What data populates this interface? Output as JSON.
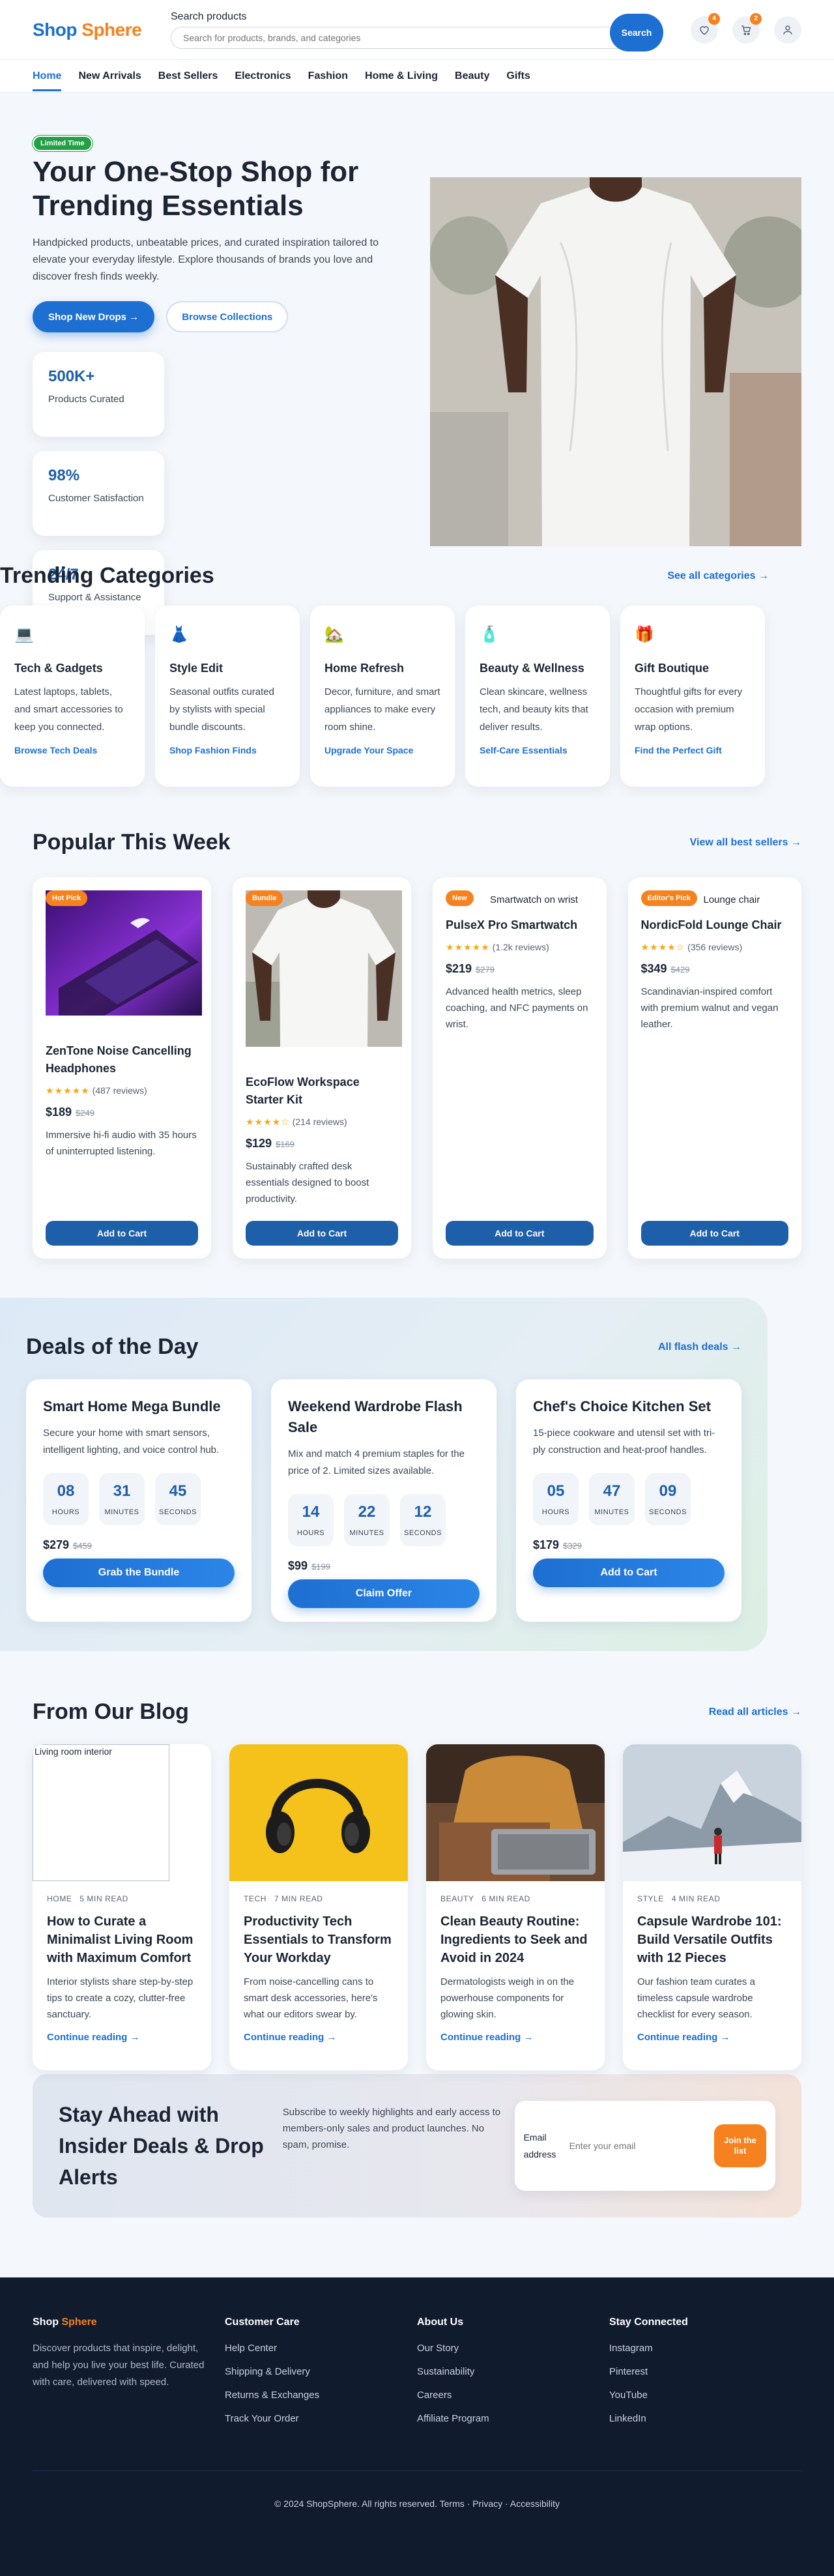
{
  "header": {
    "logo_part1": "Shop",
    "logo_part2": "Sphere",
    "search_label": "Search products",
    "search_placeholder": "Search for products, brands, and categories",
    "search_button": "Search",
    "wishlist_count": "4",
    "cart_count": "2"
  },
  "nav": {
    "items": [
      "Home",
      "New Arrivals",
      "Best Sellers",
      "Electronics",
      "Fashion",
      "Home & Living",
      "Beauty",
      "Gifts"
    ]
  },
  "hero": {
    "tag": "Limited Time",
    "title": "Your One-Stop Shop for Trending Essentials",
    "lead": "Handpicked products, unbeatable prices, and curated inspiration tailored to elevate your everyday lifestyle. Explore thousands of brands you love and discover fresh finds weekly.",
    "primary_cta": "Shop New Drops →",
    "secondary_cta": "Browse Collections",
    "stats": [
      {
        "value": "500K+",
        "label": "Products Curated"
      },
      {
        "value": "98%",
        "label": "Customer Satisfaction"
      },
      {
        "value": "24/7",
        "label": "Support & Assistance"
      }
    ]
  },
  "categories": {
    "title": "Trending Categories",
    "see_all": "See all categories →",
    "items": [
      {
        "icon": "laptop-icon",
        "glyph": "💻",
        "title": "Tech & Gadgets",
        "desc": "Latest laptops, tablets, and smart accessories to keep you connected.",
        "link": "Browse Tech Deals"
      },
      {
        "icon": "dress-icon",
        "glyph": "👗",
        "title": "Style Edit",
        "desc": "Seasonal outfits curated by stylists with special bundle discounts.",
        "link": "Shop Fashion Finds"
      },
      {
        "icon": "house-icon",
        "glyph": "🏡",
        "title": "Home Refresh",
        "desc": "Decor, furniture, and smart appliances to make every room shine.",
        "link": "Upgrade Your Space"
      },
      {
        "icon": "lotion-icon",
        "glyph": "🧴",
        "title": "Beauty & Wellness",
        "desc": "Clean skincare, wellness tech, and beauty kits that deliver results.",
        "link": "Self-Care Essentials"
      },
      {
        "icon": "gift-icon",
        "glyph": "🎁",
        "title": "Gift Boutique",
        "desc": "Thoughtful gifts for every occasion with premium wrap options.",
        "link": "Find the Perfect Gift"
      }
    ]
  },
  "popular": {
    "title": "Popular This Week",
    "view_all": "View all best sellers →",
    "add_label": "Add to Cart",
    "products": [
      {
        "tag": "Hot Pick",
        "name": "ZenTone Noise Cancelling Headphones",
        "stars": "★★★★★",
        "reviews": "(487 reviews)",
        "price": "$189",
        "old": "$249",
        "desc": "Immersive hi-fi audio with 35 hours of uninterrupted listening."
      },
      {
        "tag": "Bundle",
        "name": "EcoFlow Workspace Starter Kit",
        "stars": "★★★★☆",
        "reviews": "(214 reviews)",
        "price": "$129",
        "old": "$169",
        "desc": "Sustainably crafted desk essentials designed to boost productivity."
      },
      {
        "tag": "New",
        "alt": "Smartwatch on wrist",
        "name": "PulseX Pro Smartwatch",
        "stars": "★★★★★",
        "reviews": "(1.2k reviews)",
        "price": "$219",
        "old": "$279",
        "desc": "Advanced health metrics, sleep coaching, and NFC payments on wrist."
      },
      {
        "tag": "Editor's Pick",
        "alt": "Lounge chair",
        "name": "NordicFold Lounge Chair",
        "stars": "★★★★☆",
        "reviews": "(356 reviews)",
        "price": "$349",
        "old": "$429",
        "desc": "Scandinavian-inspired comfort with premium walnut and vegan leather."
      }
    ]
  },
  "deals": {
    "title": "Deals of the Day",
    "all_link": "All flash deals →",
    "units": [
      "HOURS",
      "MINUTES",
      "SECONDS"
    ],
    "items": [
      {
        "title": "Smart Home Mega Bundle",
        "desc": "Secure your home with smart sensors, intelligent lighting, and voice control hub.",
        "h": "08",
        "m": "31",
        "s": "45",
        "price": "$279",
        "old": "$459",
        "cta": "Grab the Bundle"
      },
      {
        "title": "Weekend Wardrobe Flash Sale",
        "desc": "Mix and match 4 premium staples for the price of 2. Limited sizes available.",
        "h": "14",
        "m": "22",
        "s": "12",
        "price": "$99",
        "old": "$199",
        "cta": "Claim Offer"
      },
      {
        "title": "Chef's Choice Kitchen Set",
        "desc": "15-piece cookware and utensil set with tri-ply construction and heat-proof handles.",
        "h": "05",
        "m": "47",
        "s": "09",
        "price": "$179",
        "old": "$329",
        "cta": "Add to Cart"
      }
    ]
  },
  "blog": {
    "title": "From Our Blog",
    "read_all": "Read all articles →",
    "posts": [
      {
        "alt": "Living room interior",
        "cat": "HOME",
        "read": "5 MIN READ",
        "title": "How to Curate a Minimalist Living Room with Maximum Comfort",
        "desc": "Interior stylists share step-by-step tips to create a cozy, clutter-free sanctuary.",
        "link": "Continue reading →"
      },
      {
        "cat": "TECH",
        "read": "7 MIN READ",
        "title": "Productivity Tech Essentials to Transform Your Workday",
        "desc": "From noise-cancelling cans to smart desk accessories, here's what our editors swear by.",
        "link": "Continue reading →"
      },
      {
        "cat": "BEAUTY",
        "read": "6 MIN READ",
        "title": "Clean Beauty Routine: Ingredients to Seek and Avoid in 2024",
        "desc": "Dermatologists weigh in on the powerhouse components for glowing skin.",
        "link": "Continue reading →"
      },
      {
        "cat": "STYLE",
        "read": "4 MIN READ",
        "title": "Capsule Wardrobe 101: Build Versatile Outfits with 12 Pieces",
        "desc": "Our fashion team curates a timeless capsule wardrobe checklist for every season.",
        "link": "Continue reading →"
      }
    ]
  },
  "newsletter": {
    "title": "Stay Ahead with Insider Deals & Drop Alerts",
    "text": "Subscribe to weekly highlights and early access to members-only sales and product launches. No spam, promise.",
    "email_label": "Email address",
    "placeholder": "Enter your email",
    "button": "Join the list"
  },
  "footer": {
    "brand1": "Shop",
    "brand2": "Sphere",
    "about": "Discover products that inspire, delight, and help you live your best life. Curated with care, delivered with speed.",
    "col2_title": "Customer Care",
    "col2": [
      "Help Center",
      "Shipping & Delivery",
      "Returns & Exchanges",
      "Track Your Order"
    ],
    "col3_title": "About Us",
    "col3": [
      "Our Story",
      "Sustainability",
      "Careers",
      "Affiliate Program"
    ],
    "col4_title": "Stay Connected",
    "col4": [
      "Instagram",
      "Pinterest",
      "YouTube",
      "LinkedIn"
    ],
    "copyright": "© 2024 ShopSphere. All rights reserved.",
    "terms": "Terms",
    "privacy": "Privacy",
    "accessibility": "Accessibility"
  }
}
